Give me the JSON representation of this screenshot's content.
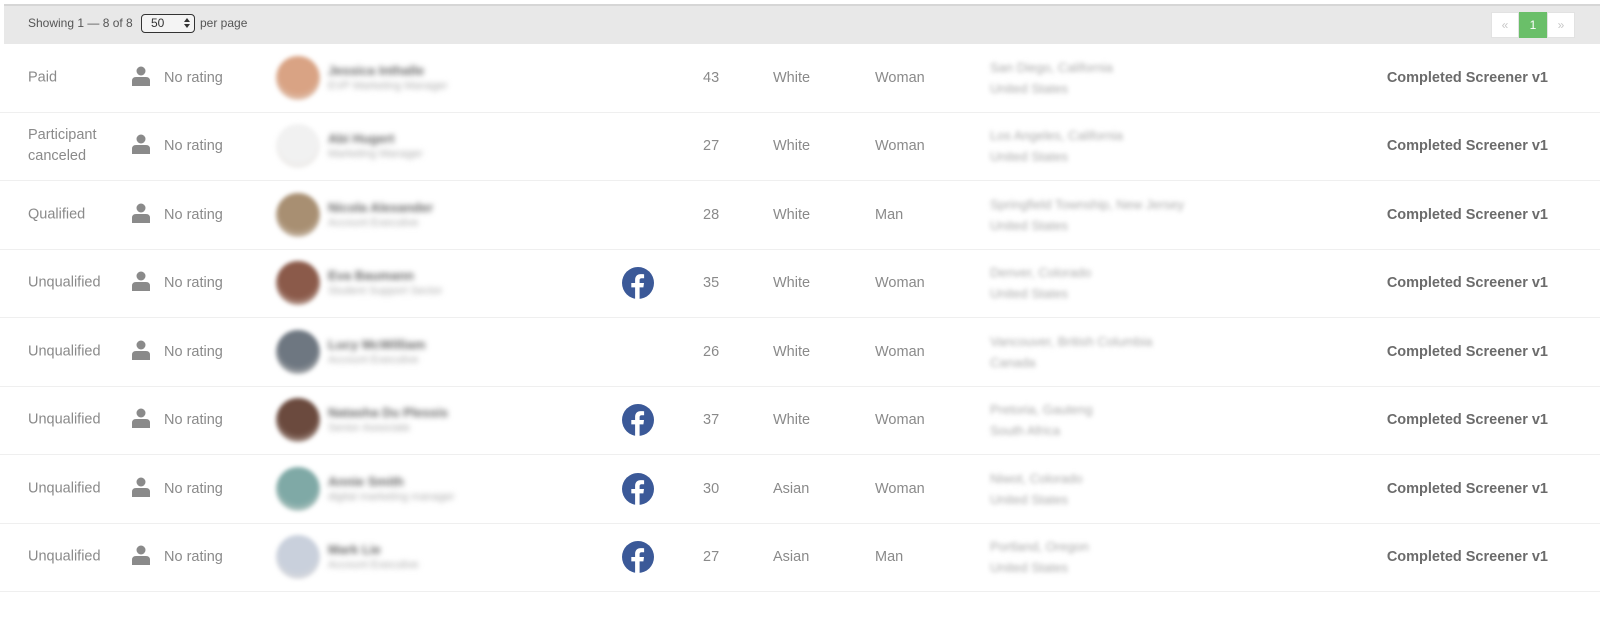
{
  "header": {
    "showing_text": "Showing 1 — 8 of 8",
    "per_page_value": "50",
    "per_page_label": "per page",
    "pager": {
      "prev_label": "«",
      "current_page": "1",
      "next_label": "»"
    }
  },
  "colors": {
    "pager_active": "#6abf69",
    "facebook_blue": "#3b5998",
    "topbar_bg": "#e8e8e8"
  },
  "rows": [
    {
      "status": "Paid",
      "rating": "No rating",
      "name": "Jessica Inthalle",
      "role": "EVP Marketing Manager",
      "has_facebook": false,
      "age": "43",
      "race": "White",
      "gender": "Woman",
      "location_line1": "San Diego, California",
      "location_line2": "United States",
      "screener": "Completed Screener v1",
      "avatar_color": "#d9a384"
    },
    {
      "status": "Participant canceled",
      "rating": "No rating",
      "name": "Abi Hugert",
      "role": "Marketing Manager",
      "has_facebook": false,
      "age": "27",
      "race": "White",
      "gender": "Woman",
      "location_line1": "Los Angeles, California",
      "location_line2": "United States",
      "screener": "Completed Screener v1",
      "avatar_color": "#f1f1f1"
    },
    {
      "status": "Qualified",
      "rating": "No rating",
      "name": "Nicola Alexander",
      "role": "Account Executive",
      "has_facebook": false,
      "age": "28",
      "race": "White",
      "gender": "Man",
      "location_line1": "Springfield Township, New Jersey",
      "location_line2": "United States",
      "screener": "Completed Screener v1",
      "avatar_color": "#a88f72"
    },
    {
      "status": "Unqualified",
      "rating": "No rating",
      "name": "Eva Baumann",
      "role": "Student Support Sector",
      "has_facebook": true,
      "age": "35",
      "race": "White",
      "gender": "Woman",
      "location_line1": "Denver, Colorado",
      "location_line2": "United States",
      "screener": "Completed Screener v1",
      "avatar_color": "#8b5a4a"
    },
    {
      "status": "Unqualified",
      "rating": "No rating",
      "name": "Lucy McWilliam",
      "role": "Account Executive",
      "has_facebook": false,
      "age": "26",
      "race": "White",
      "gender": "Woman",
      "location_line1": "Vancouver, British Columbia",
      "location_line2": "Canada",
      "screener": "Completed Screener v1",
      "avatar_color": "#6e7781"
    },
    {
      "status": "Unqualified",
      "rating": "No rating",
      "name": "Natasha Du Plessis",
      "role": "Senior Associate",
      "has_facebook": true,
      "age": "37",
      "race": "White",
      "gender": "Woman",
      "location_line1": "Pretoria, Gauteng",
      "location_line2": "South Africa",
      "screener": "Completed Screener v1",
      "avatar_color": "#6b4a3e"
    },
    {
      "status": "Unqualified",
      "rating": "No rating",
      "name": "Annie Smith",
      "role": "digital marketing manager",
      "has_facebook": true,
      "age": "30",
      "race": "Asian",
      "gender": "Woman",
      "location_line1": "Niwot, Colorado",
      "location_line2": "United States",
      "screener": "Completed Screener v1",
      "avatar_color": "#7fa9a6"
    },
    {
      "status": "Unqualified",
      "rating": "No rating",
      "name": "Mark Lie",
      "role": "Account Executive",
      "has_facebook": true,
      "age": "27",
      "race": "Asian",
      "gender": "Man",
      "location_line1": "Portland, Oregon",
      "location_line2": "United States",
      "screener": "Completed Screener v1",
      "avatar_color": "#c9d0dc"
    }
  ]
}
